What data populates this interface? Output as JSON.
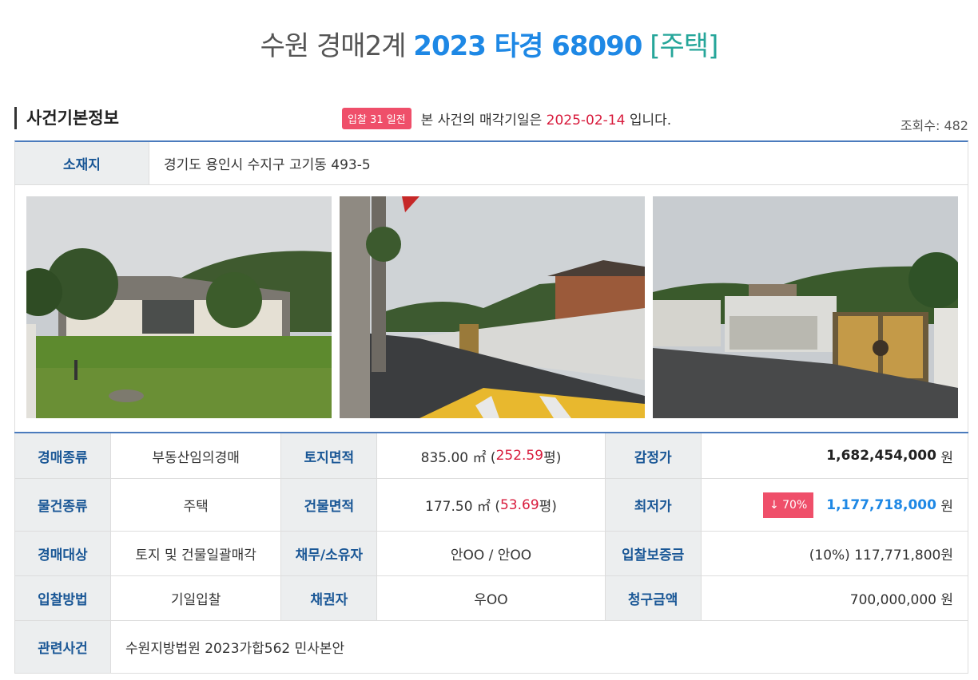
{
  "header": {
    "court": "수원 경매2계",
    "case_no": "2023 타경 68090",
    "kind": "[주택]"
  },
  "section": {
    "title": "사건기본정보",
    "badge": "입찰 31 일전",
    "notice_prefix": "본 사건의 매각기일은",
    "notice_date": "2025-02-14",
    "notice_suffix": "입니다.",
    "views": "조회수: 482"
  },
  "address": {
    "label": "소재지",
    "value": "경기도 용인시 수지구 고기동 493-5"
  },
  "photos": [
    {
      "name": "house-front-photo"
    },
    {
      "name": "street-view-photo"
    },
    {
      "name": "gate-view-photo"
    }
  ],
  "details": {
    "auction_type_label": "경매종류",
    "auction_type": "부동산임의경매",
    "land_area_label": "토지면적",
    "land_area_m2": "835.00 ㎡ (",
    "land_area_py": "252.59",
    "land_area_unit": "평)",
    "appraisal_label": "감정가",
    "appraisal": "1,682,454,000",
    "won": "원",
    "item_type_label": "물건종류",
    "item_type": "주택",
    "building_area_label": "건물면적",
    "building_area_m2": "177.50 ㎡ (",
    "building_area_py": "53.69",
    "building_area_unit": "평)",
    "min_price_label": "최저가",
    "min_price_badge": "↓ 70%",
    "min_price": "1,177,718,000",
    "target_label": "경매대상",
    "target": "토지 및 건물일괄매각",
    "debtor_label": "채무/소유자",
    "debtor": "안OO / 안OO",
    "deposit_label": "입찰보증금",
    "deposit": "(10%) 117,771,800원",
    "bid_method_label": "입찰방법",
    "bid_method": "기일입찰",
    "creditor_label": "채권자",
    "creditor": "우OO",
    "claim_label": "청구금액",
    "claim": "700,000,000 원",
    "related_label": "관련사건",
    "related": "수원지방법원 2023가합562 민사본안"
  }
}
